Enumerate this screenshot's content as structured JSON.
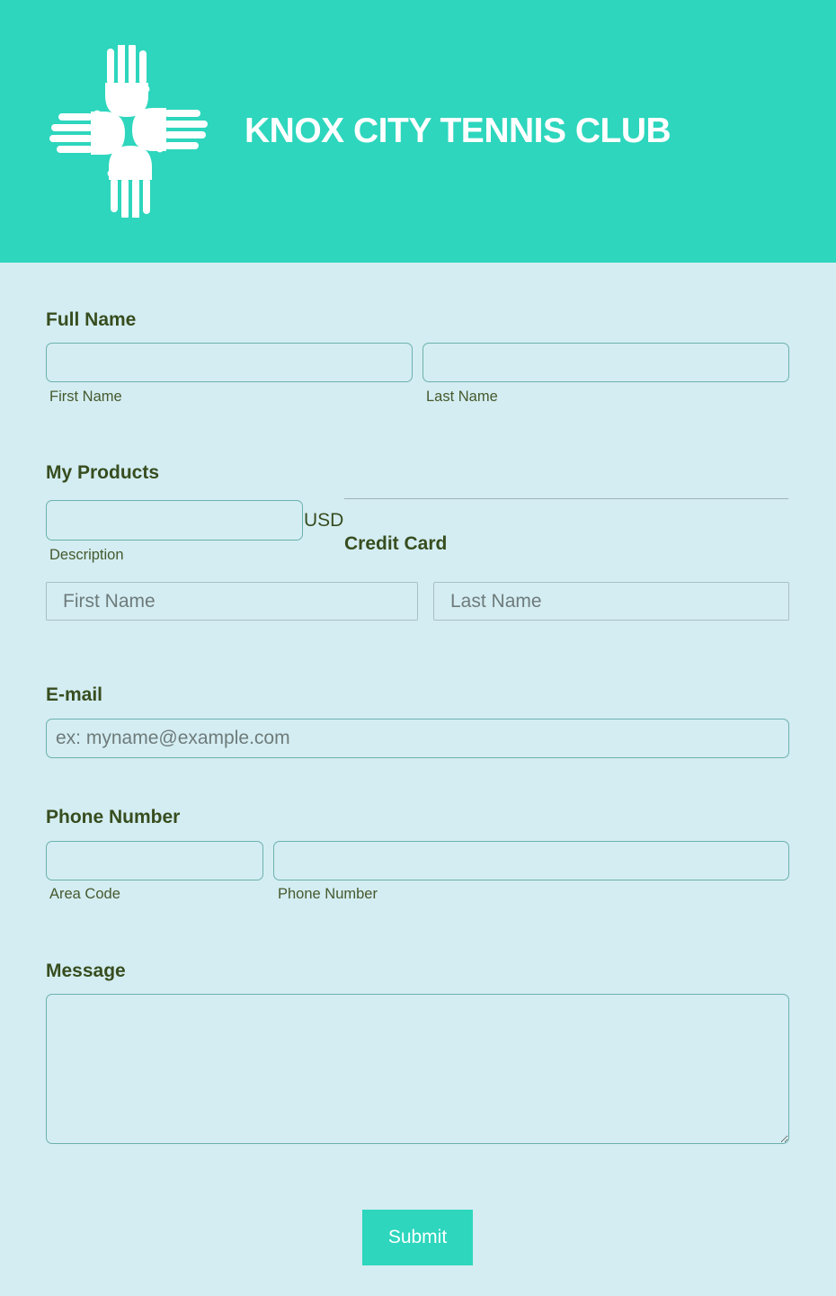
{
  "header": {
    "logo_icon": "four-hands-icon",
    "title": "KNOX CITY TENNIS CLUB",
    "background_color": "#2dd6bd"
  },
  "form": {
    "full_name": {
      "label": "Full Name",
      "first_sublabel": "First Name",
      "last_sublabel": "Last Name",
      "first_value": "",
      "last_value": ""
    },
    "products": {
      "label": "My Products",
      "description_value": "",
      "description_sublabel": "Description",
      "currency": "USD",
      "credit_card_label": "Credit Card",
      "cc_first_placeholder": "First Name",
      "cc_last_placeholder": "Last Name"
    },
    "email": {
      "label": "E-mail",
      "placeholder": "ex: myname@example.com",
      "value": ""
    },
    "phone": {
      "label": "Phone Number",
      "area_sublabel": "Area Code",
      "number_sublabel": "Phone Number",
      "area_value": "",
      "number_value": ""
    },
    "message": {
      "label": "Message",
      "value": ""
    },
    "submit_label": "Submit"
  },
  "colors": {
    "accent": "#2dd6bd",
    "page_background": "#d4edf2",
    "label_text": "#374d1f",
    "field_border": "#6bb1ad"
  }
}
